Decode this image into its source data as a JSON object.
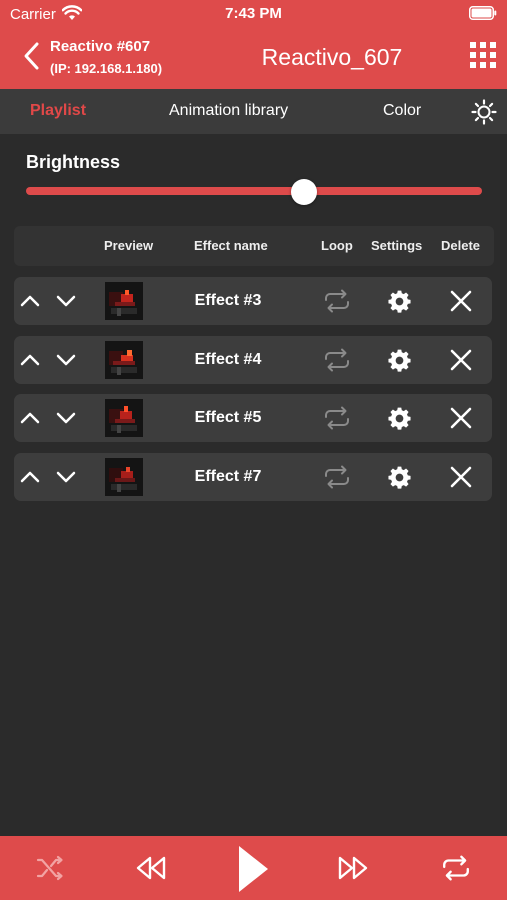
{
  "status_bar": {
    "carrier": "Carrier",
    "time": "7:43 PM",
    "icons": [
      "wifi-icon",
      "battery-icon"
    ]
  },
  "nav": {
    "device_name": "Reactivo #607",
    "device_ip": "(IP: 192.168.1.180)",
    "title": "Reactivo_607",
    "icons": [
      "chevron-left-icon",
      "grid-icon"
    ]
  },
  "tabs": {
    "items": [
      "Playlist",
      "Animation library",
      "Color"
    ],
    "active": "Playlist",
    "icon": "sun-icon"
  },
  "brightness": {
    "label": "Brightness",
    "value_fraction": 0.61
  },
  "table": {
    "headers": {
      "preview": "Preview",
      "effect_name": "Effect name",
      "loop": "Loop",
      "settings": "Settings",
      "delete": "Delete"
    },
    "rows": [
      {
        "name": "Effect #3"
      },
      {
        "name": "Effect #4"
      },
      {
        "name": "Effect #5"
      },
      {
        "name": "Effect #7"
      }
    ]
  },
  "bottom_bar": {
    "icons": [
      "shuffle-icon",
      "rewind-icon",
      "play-icon",
      "fast-forward-icon",
      "repeat-icon"
    ]
  },
  "colors": {
    "accent": "#de4b4b",
    "active_tab": "#e04848",
    "background": "#2b2b2b",
    "tab_bar": "#3b3b3b",
    "row": "#3d3d3d"
  }
}
